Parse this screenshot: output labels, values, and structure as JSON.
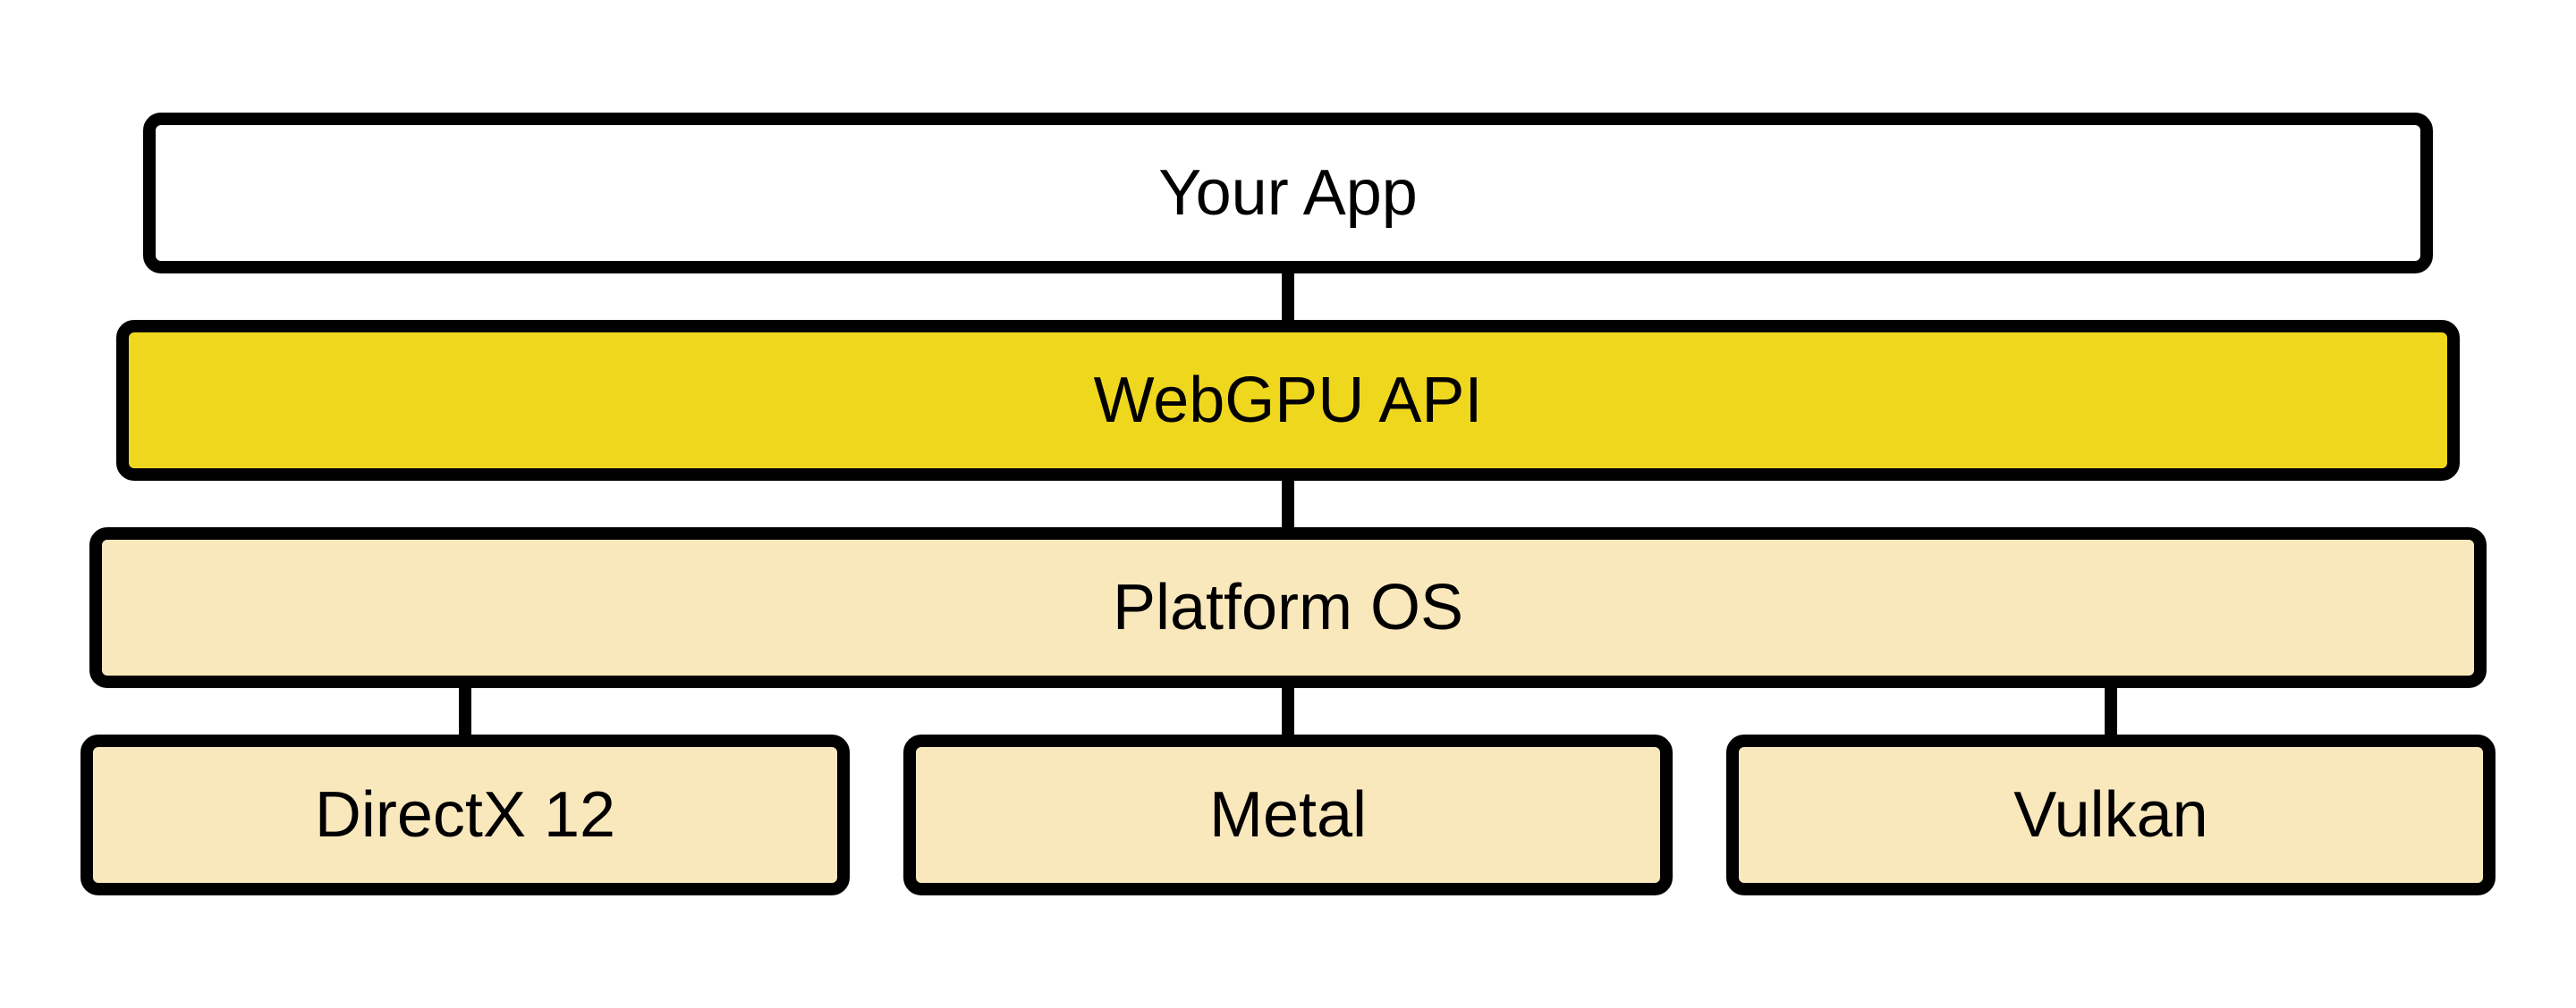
{
  "layers": {
    "app": "Your App",
    "webgpu": "WebGPU API",
    "platform": "Platform OS",
    "backends": [
      "DirectX 12",
      "Metal",
      "Vulkan"
    ]
  },
  "colors": {
    "app_bg": "#ffffff",
    "webgpu_bg": "#efd71e",
    "platform_bg": "#fae8bd",
    "backend_bg": "#fae8bd",
    "border": "#000000"
  }
}
